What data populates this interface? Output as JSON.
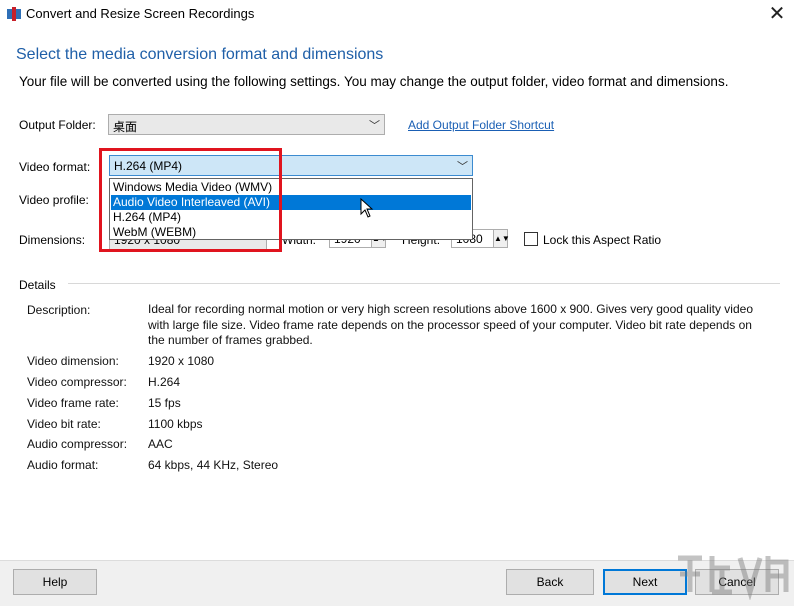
{
  "window": {
    "title": "Convert and Resize Screen Recordings",
    "close_glyph": "✕"
  },
  "heading": "Select the media conversion format and dimensions",
  "subtext": "Your file will be converted using the following settings. You may change the output folder, video format and dimensions.",
  "output_folder": {
    "label": "Output Folder:",
    "value": "桌面",
    "shortcut_link": "Add Output Folder Shortcut"
  },
  "video_format": {
    "label": "Video format:",
    "value": "H.264 (MP4)",
    "options": [
      "Windows Media Video (WMV)",
      "Audio Video Interleaved (AVI)",
      "H.264 (MP4)",
      "WebM (WEBM)"
    ],
    "highlighted_option": "Audio Video Interleaved (AVI)"
  },
  "video_profile": {
    "label": "Video profile:"
  },
  "dimensions": {
    "label": "Dimensions:",
    "value": "1920 x 1080",
    "width_label": "Width:",
    "width_value": "1920",
    "height_label": "Height:",
    "height_value": "1080",
    "lock_label": "Lock this Aspect Ratio",
    "lock_checked": false
  },
  "details": {
    "header": "Details",
    "description_label": "Description:",
    "description": "Ideal for recording normal motion or very high screen resolutions above 1600 x 900.   Gives very good quality video with large file size. Video frame rate depends on the processor speed of your computer. Video bit rate depends on the number of frames grabbed.",
    "rows": [
      {
        "label": "Video dimension:",
        "value": "1920 x 1080"
      },
      {
        "label": "Video compressor:",
        "value": "H.264"
      },
      {
        "label": "Video frame rate:",
        "value": "15 fps"
      },
      {
        "label": "Video bit rate:",
        "value": "1100 kbps"
      },
      {
        "label": "Audio compressor:",
        "value": "AAC"
      },
      {
        "label": "Audio format:",
        "value": "64 kbps, 44 KHz, Stereo"
      }
    ]
  },
  "buttons": {
    "help": "Help",
    "back": "Back",
    "next": "Next",
    "cancel": "Cancel"
  },
  "colors": {
    "heading": "#1f5fa8",
    "selection": "#0078d7",
    "annotation": "#e0141e",
    "link": "#1a5fb4"
  }
}
